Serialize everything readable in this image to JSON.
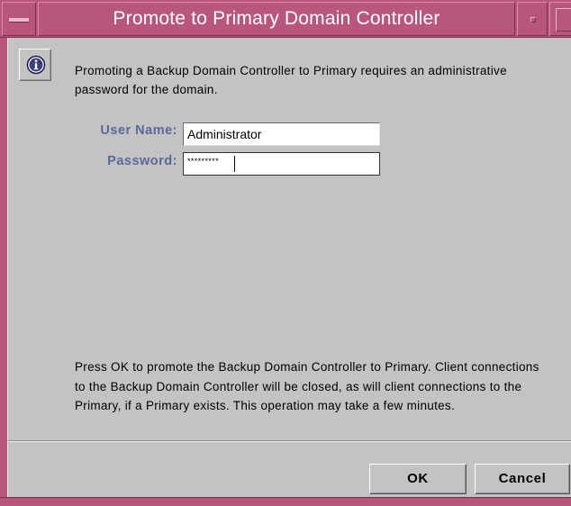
{
  "window": {
    "title": "Promote to Primary Domain Controller"
  },
  "intro_text": "Promoting a Backup Domain Controller to Primary requires an administrative password for the domain.",
  "form": {
    "user_label": "User Name:",
    "user_value": "Administrator",
    "password_label": "Password:",
    "password_value": "*********"
  },
  "note_text": "Press OK to promote the Backup Domain Controller to Primary. Client connections to the Backup Domain Controller will be closed, as will client connections to the Primary, if a Primary exists. This operation may take a few minutes.",
  "buttons": {
    "ok": "OK",
    "cancel": "Cancel"
  },
  "colors": {
    "titlebar": "#b8567e",
    "dialog_bg": "#c3c3c3",
    "label": "#5a6a9a"
  },
  "icons": {
    "info": "info-icon",
    "window_menu": "window-menu-icon",
    "minimize": "minimize-icon",
    "maximize": "maximize-icon"
  }
}
